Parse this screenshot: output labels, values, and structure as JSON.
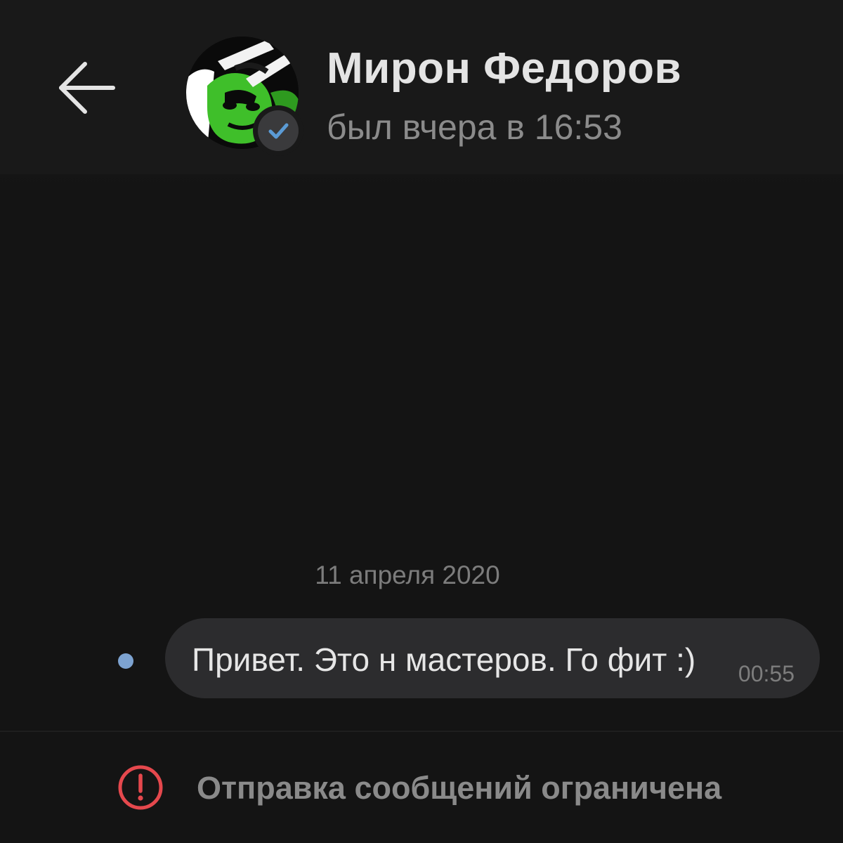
{
  "header": {
    "back_icon": "arrow-left-icon",
    "contact_name": "Мирон Федоров",
    "last_seen": "был вчера в 16:53",
    "avatar_icon": "contact-avatar",
    "verified_icon": "verified-check-icon"
  },
  "chat": {
    "date_label": "11 апреля 2020",
    "messages": [
      {
        "text": "Привет. Это н мастеров. Го фит :)",
        "time": "00:55",
        "unread": true
      }
    ]
  },
  "footer": {
    "icon": "exclamation-circle-icon",
    "restriction_text": "Отправка сообщений ограничена"
  },
  "colors": {
    "background": "#141414",
    "header": "#191919",
    "bubble": "#2c2c2e",
    "verified_check": "#5b9bd5",
    "unread_dot": "#7da3d1",
    "warning": "#e5484d"
  }
}
